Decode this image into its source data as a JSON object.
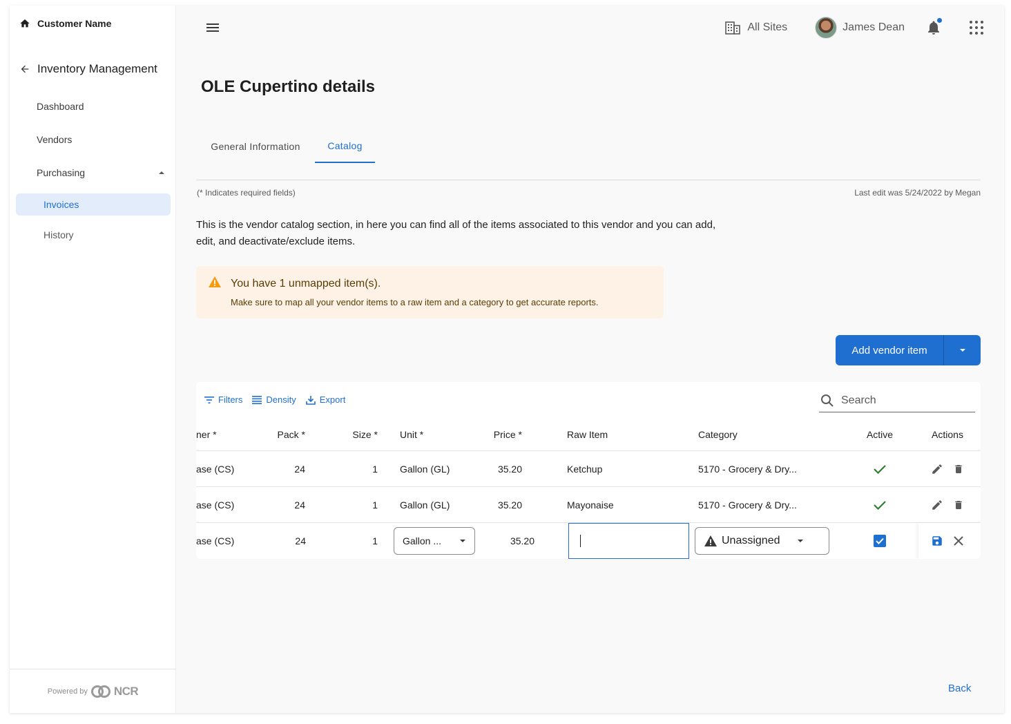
{
  "sidebar": {
    "customer": "Customer Name",
    "back_label": "Inventory Management",
    "items": [
      {
        "label": "Dashboard"
      },
      {
        "label": "Vendors"
      },
      {
        "label": "Purchasing"
      }
    ],
    "sub_items": [
      {
        "label": "Invoices",
        "active": true
      },
      {
        "label": "History",
        "active": false
      }
    ],
    "powered_by": "Powered by",
    "brand": "NCR"
  },
  "topbar": {
    "sites": "All Sites",
    "user_name": "James Dean"
  },
  "page": {
    "title": "OLE Cupertino details",
    "tabs": [
      {
        "label": "General Information",
        "active": false
      },
      {
        "label": "Catalog",
        "active": true
      }
    ],
    "required_note": "(* Indicates required fields)",
    "last_edit": "Last edit was 5/24/2022 by Megan",
    "intro": "This is the vendor catalog section, in here you can find all of the items associated to this vendor and you can add, edit, and deactivate/exclude items."
  },
  "alert": {
    "title": "You have 1 unmapped item(s).",
    "body": "Make sure to map all your vendor items to a raw item  and a category to get accurate reports."
  },
  "add_button": {
    "label": "Add vendor item"
  },
  "grid": {
    "toolbar": {
      "filters": "Filters",
      "density": "Density",
      "export": "Export"
    },
    "search_placeholder": "Search",
    "headers": {
      "name": "ner *",
      "pack": "Pack *",
      "size": "Size *",
      "unit": "Unit *",
      "price": "Price *",
      "raw_item": "Raw Item",
      "category": "Category",
      "active": "Active",
      "actions": "Actions"
    },
    "rows": [
      {
        "name": "ase (CS)",
        "pack": "24",
        "size": "1",
        "unit": "Gallon (GL)",
        "price": "35.20",
        "raw_item": "Ketchup",
        "category": "5170 - Grocery & Dry...",
        "active": true
      },
      {
        "name": "ase (CS)",
        "pack": "24",
        "size": "1",
        "unit": "Gallon (GL)",
        "price": "35.20",
        "raw_item": "Mayonaise",
        "category": "5170 - Grocery & Dry...",
        "active": true
      }
    ],
    "edit_row": {
      "name": "ase (CS)",
      "pack": "24",
      "size": "1",
      "unit": "Gallon ...",
      "price": "35.20",
      "raw_item": "",
      "category": "Unassigned",
      "active": true
    }
  },
  "footer": {
    "back": "Back"
  },
  "colors": {
    "accent": "#1f6fd1",
    "success": "#2e7d32",
    "warning": "#f39c12",
    "alert_bg": "#fdf2e5"
  }
}
